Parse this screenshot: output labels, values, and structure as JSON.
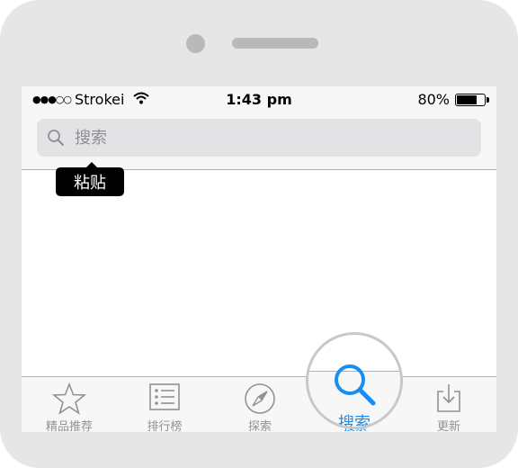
{
  "status_bar": {
    "signal": "●●●○○",
    "carrier": "Strokei",
    "time": "1:43 pm",
    "battery_text": "80%",
    "battery_level": 0.8
  },
  "search": {
    "placeholder": "搜索",
    "value": ""
  },
  "context_menu": {
    "paste_label": "粘贴"
  },
  "tabs": [
    {
      "label": "精品推荐",
      "icon": "star-icon",
      "active": false
    },
    {
      "label": "排行榜",
      "icon": "list-icon",
      "active": false
    },
    {
      "label": "探索",
      "icon": "compass-icon",
      "active": false
    },
    {
      "label": "搜索",
      "icon": "search-icon",
      "active": true
    },
    {
      "label": "更新",
      "icon": "download-icon",
      "active": false
    }
  ],
  "colors": {
    "accent": "#1a8df2",
    "inactive": "#929292",
    "bar": "#f7f7f7"
  }
}
